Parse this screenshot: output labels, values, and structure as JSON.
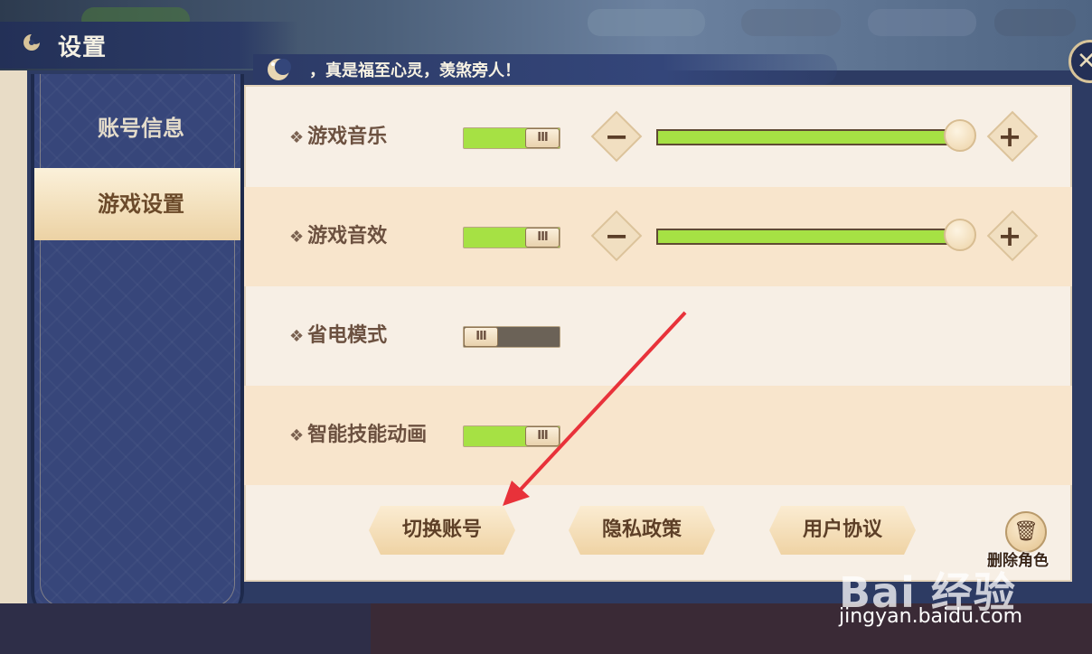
{
  "header": {
    "title": "设置"
  },
  "tip": {
    "text": "，真是福至心灵，羡煞旁人！"
  },
  "sidebar": {
    "items": [
      {
        "label": "账号信息",
        "active": false
      },
      {
        "label": "游戏设置",
        "active": true
      }
    ]
  },
  "settings": {
    "music": {
      "label": "游戏音乐",
      "enabled": true,
      "volume": 1.0
    },
    "sfx": {
      "label": "游戏音效",
      "enabled": true,
      "volume": 1.0
    },
    "power_saving": {
      "label": "省电模式",
      "enabled": false
    },
    "skill_animation": {
      "label": "智能技能动画",
      "enabled": true
    }
  },
  "toggle_knob_glyph": "III",
  "actions": {
    "switch_account": "切换账号",
    "privacy_policy": "隐私政策",
    "user_agreement": "用户协议",
    "delete_character": "删除角色"
  },
  "watermark": {
    "brand": "Bai 经验",
    "url": "jingyan.baidu.com"
  },
  "icons": {
    "title": "moon-icon",
    "tip": "moon-icon",
    "close": "close-icon",
    "minus": "minus-icon",
    "plus": "plus-icon",
    "delete": "trash-icon"
  },
  "colors": {
    "accent_green": "#a6e144",
    "panel_bg": "#f7efe5",
    "row_highlight": "#f8e5cc",
    "sidebar_bg": "#37467a",
    "annotation_arrow": "#e8323a"
  }
}
